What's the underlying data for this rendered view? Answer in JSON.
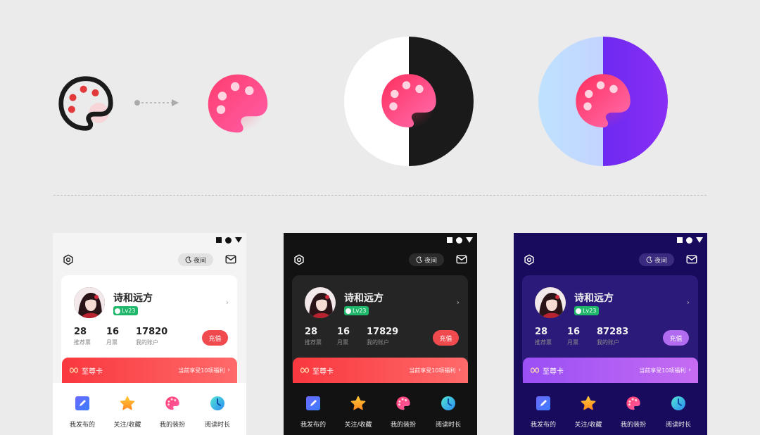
{
  "colors": {
    "brand_red": "#f04a4f",
    "brand_pink": "#ff4f8b",
    "level_green": "#1fb86a",
    "purple_accent": "#8a2ef5",
    "dark_bg": "#121212",
    "purple_bg": "#180a5c"
  },
  "showcase": {
    "icons": [
      "palette-outline-icon",
      "arrow-right-icon",
      "palette-gradient-icon",
      "palette-on-light-dark-split",
      "palette-on-blue-purple-split"
    ]
  },
  "phones": [
    {
      "theme": "light",
      "night_label": "夜间",
      "user": {
        "name": "诗和远方",
        "level": "Lv23"
      },
      "stats": [
        {
          "value": "28",
          "label": "推荐票"
        },
        {
          "value": "16",
          "label": "月票"
        },
        {
          "value": "17820",
          "label": "我的账户"
        }
      ],
      "recharge_label": "充值",
      "vip": {
        "title": "至尊卡",
        "desc": "当前享受10项福利"
      },
      "bottom_nav": [
        {
          "label": "我发布的",
          "icon": "pencil-icon"
        },
        {
          "label": "关注/收藏",
          "icon": "star-icon"
        },
        {
          "label": "我的装扮",
          "icon": "palette-icon"
        },
        {
          "label": "阅读时长",
          "icon": "clock-icon"
        }
      ]
    },
    {
      "theme": "dark",
      "night_label": "夜间",
      "user": {
        "name": "诗和远方",
        "level": "Lv23"
      },
      "stats": [
        {
          "value": "28",
          "label": "推荐票"
        },
        {
          "value": "16",
          "label": "月票"
        },
        {
          "value": "17829",
          "label": "我的账户"
        }
      ],
      "recharge_label": "充值",
      "vip": {
        "title": "至尊卡",
        "desc": "当前享受10项福利"
      },
      "bottom_nav": [
        {
          "label": "我发布的",
          "icon": "pencil-icon"
        },
        {
          "label": "关注/收藏",
          "icon": "star-icon"
        },
        {
          "label": "我的装扮",
          "icon": "palette-icon"
        },
        {
          "label": "阅读时长",
          "icon": "clock-icon"
        }
      ]
    },
    {
      "theme": "purple",
      "night_label": "夜间",
      "user": {
        "name": "诗和远方",
        "level": "Lv23"
      },
      "stats": [
        {
          "value": "28",
          "label": "推荐票"
        },
        {
          "value": "16",
          "label": "月票"
        },
        {
          "value": "87283",
          "label": "我的账户"
        }
      ],
      "recharge_label": "充值",
      "vip": {
        "title": "至尊卡",
        "desc": "当前享受10项福利"
      },
      "bottom_nav": [
        {
          "label": "我发布的",
          "icon": "pencil-icon"
        },
        {
          "label": "关注/收藏",
          "icon": "star-icon"
        },
        {
          "label": "我的装扮",
          "icon": "palette-icon"
        },
        {
          "label": "阅读时长",
          "icon": "clock-icon"
        }
      ]
    }
  ]
}
